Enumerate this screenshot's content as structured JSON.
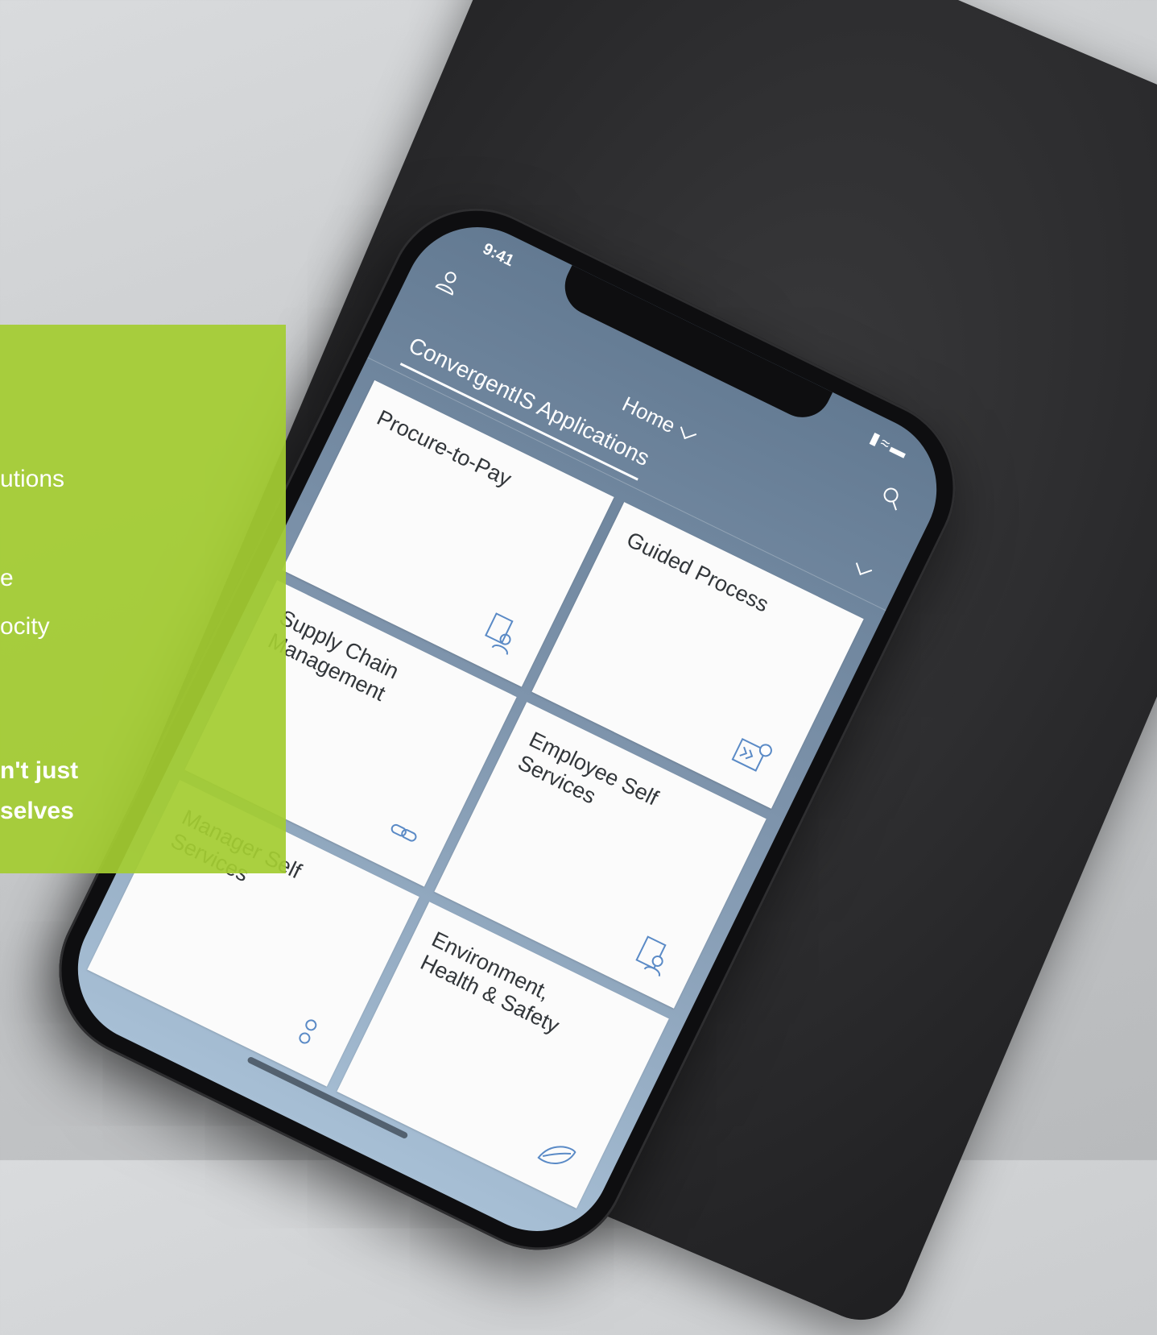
{
  "phone": {
    "status_time": "9:41",
    "header_title": "Home",
    "active_tab": "ConvergentIS Applications",
    "tiles": [
      {
        "title": "Procure-to-Pay",
        "icon": "invoice-user-icon"
      },
      {
        "title": "Guided Process",
        "icon": "process-clock-icon"
      },
      {
        "title": "Supply Chain\nManagement",
        "icon": "link-icon"
      },
      {
        "title": "Employee Self\nServices",
        "icon": "clipboard-user-icon"
      },
      {
        "title": "Manager Self\nServices",
        "icon": "team-icon"
      },
      {
        "title": "Environment,\nHealth & Safety",
        "icon": "leaf-icon"
      }
    ]
  },
  "overlay": {
    "lines": [
      "utions",
      "e",
      "ocity"
    ],
    "bold_lines": [
      "n't just",
      "selves"
    ],
    "color": "#a4cc32"
  }
}
